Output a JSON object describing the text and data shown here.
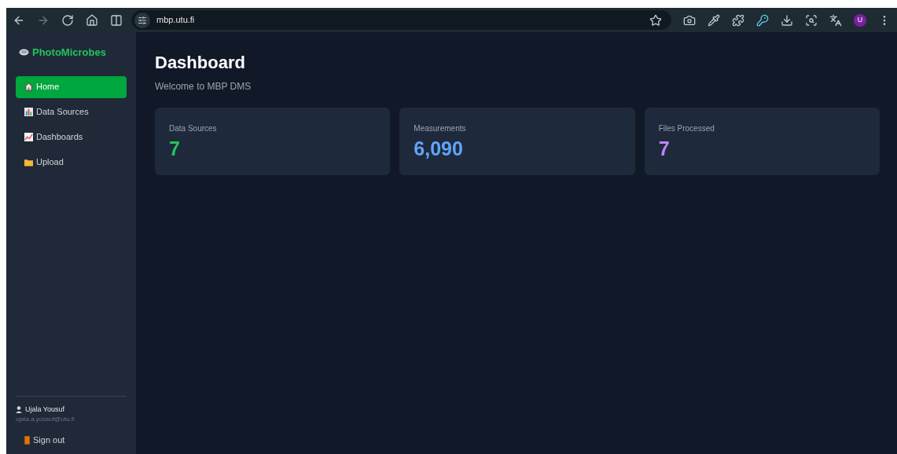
{
  "browser": {
    "url": "mbp.utu.fi",
    "profile_initial": "U"
  },
  "sidebar": {
    "brand": "PhotoMicrobes",
    "items": [
      {
        "label": "Home",
        "kind": "home",
        "selected": true
      },
      {
        "label": "Data Sources",
        "kind": "chart",
        "selected": false
      },
      {
        "label": "Dashboards",
        "kind": "trend",
        "selected": false
      },
      {
        "label": "Upload",
        "kind": "folder",
        "selected": false
      }
    ],
    "user": {
      "name": "Ujala Yousuf",
      "email": "ujala.a.yousuf@utu.fi"
    },
    "sign_out": "Sign out"
  },
  "main": {
    "title": "Dashboard",
    "subtitle": "Welcome to MBP DMS",
    "stats": [
      {
        "label": "Data Sources",
        "value": "7",
        "color": "#22c55e"
      },
      {
        "label": "Measurements",
        "value": "6,090",
        "color": "#60a5fa"
      },
      {
        "label": "Files Processed",
        "value": "7",
        "color": "#c084fc"
      }
    ]
  }
}
